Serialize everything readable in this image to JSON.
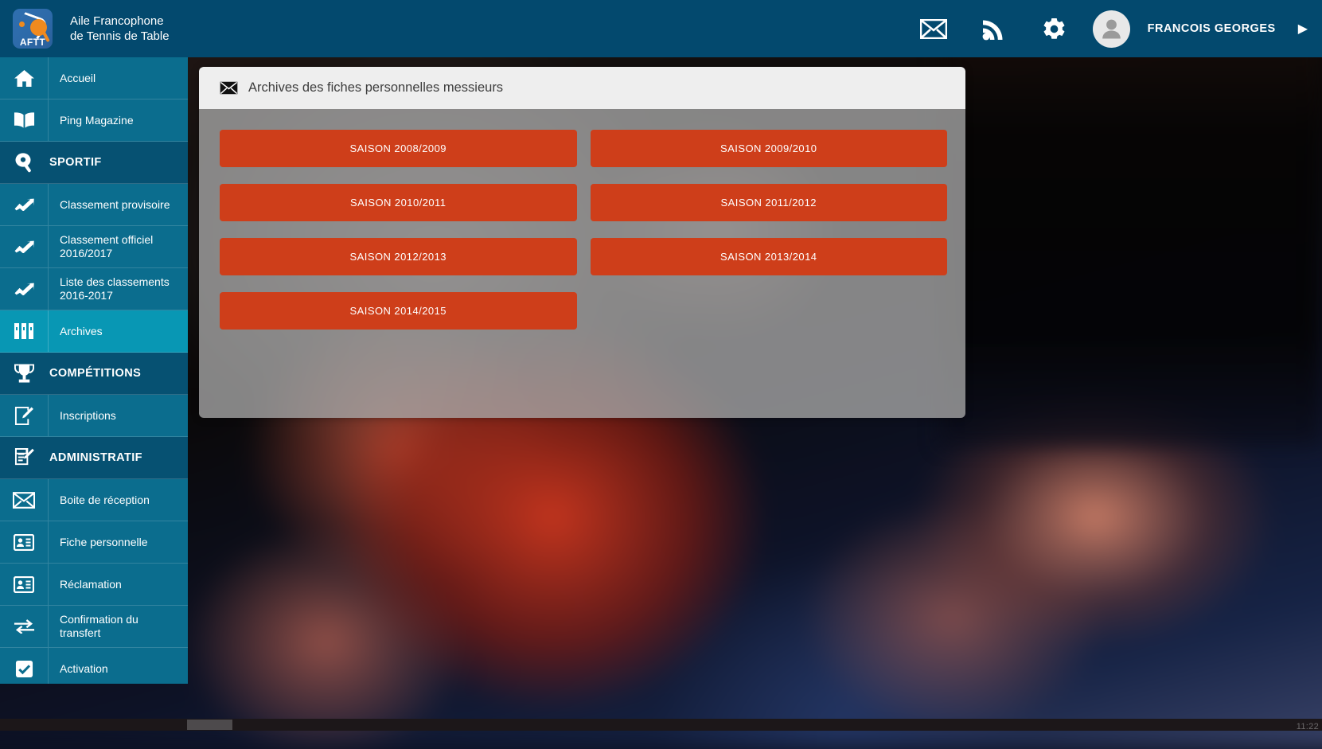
{
  "header": {
    "brand_title": "Aile Francophone\nde Tennis de Table",
    "logo_text": "AFTT",
    "icons": [
      "mail-icon",
      "rss-icon",
      "gear-icon"
    ],
    "username": "FRANCOIS GEORGES",
    "caret": "▶",
    "bg_color": "#03496e"
  },
  "sidebar": {
    "bg_color": "#0b6d8e",
    "section_color": "#065172",
    "active_color": "#0897b4",
    "items": [
      {
        "label": "Accueil",
        "icon": "home-icon",
        "type": "link",
        "active": false
      },
      {
        "label": "Ping Magazine",
        "icon": "book-icon",
        "type": "link",
        "active": false
      },
      {
        "label": "SPORTIF",
        "icon": "paddle-icon",
        "type": "section",
        "active": false
      },
      {
        "label": "Classement provisoire",
        "icon": "trend-up-icon",
        "type": "link",
        "active": false
      },
      {
        "label": "Classement officiel 2016/2017",
        "icon": "trend-up-icon",
        "type": "link",
        "active": false
      },
      {
        "label": "Liste des classements 2016-2017",
        "icon": "trend-up-icon",
        "type": "link",
        "active": false
      },
      {
        "label": "Archives",
        "icon": "archive-icon",
        "type": "link",
        "active": true
      },
      {
        "label": "COMPÉTITIONS",
        "icon": "trophy-icon",
        "type": "section",
        "active": false
      },
      {
        "label": "Inscriptions",
        "icon": "edit-note-icon",
        "type": "link",
        "active": false
      },
      {
        "label": "ADMINISTRATIF",
        "icon": "clipboard-pen-icon",
        "type": "section",
        "active": false
      },
      {
        "label": "Boite de réception",
        "icon": "mail-icon",
        "type": "link",
        "active": false
      },
      {
        "label": "Fiche personnelle",
        "icon": "id-card-icon",
        "type": "link",
        "active": false
      },
      {
        "label": "Réclamation",
        "icon": "id-card-icon",
        "type": "link",
        "active": false
      },
      {
        "label": "Confirmation du transfert",
        "icon": "transfer-icon",
        "type": "link",
        "active": false
      },
      {
        "label": "Activation",
        "icon": "checkbox-icon",
        "type": "link",
        "active": false
      }
    ]
  },
  "panel": {
    "title": "Archives des fiches personnelles messieurs",
    "title_icon": "mail-icon",
    "head_bg": "#eeeeee",
    "button_color": "#ce3e1a",
    "rows": [
      [
        {
          "label": "SAISON 2008/2009",
          "visible": true
        },
        {
          "label": "SAISON 2009/2010",
          "visible": true
        }
      ],
      [
        {
          "label": "SAISON 2010/2011",
          "visible": true
        },
        {
          "label": "SAISON 2011/2012",
          "visible": true
        }
      ],
      [
        {
          "label": "SAISON 2012/2013",
          "visible": true
        },
        {
          "label": "SAISON 2013/2014",
          "visible": true
        }
      ],
      [
        {
          "label": "SAISON 2014/2015",
          "visible": true
        },
        {
          "label": "",
          "visible": false
        }
      ]
    ]
  },
  "scrollbar": {
    "track_color": "#1c1719",
    "thumb_color": "#4d4a4c",
    "clock": "11:22"
  }
}
